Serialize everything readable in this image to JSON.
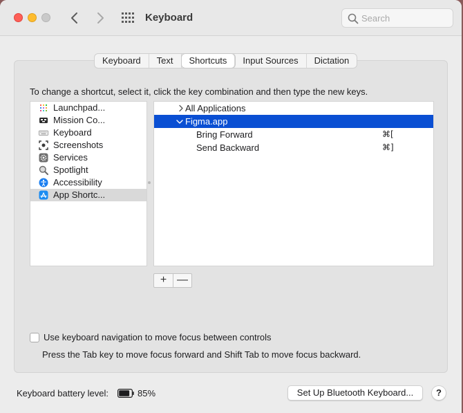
{
  "window": {
    "title": "Keyboard",
    "search_placeholder": "Search"
  },
  "tabs": [
    {
      "label": "Keyboard",
      "active": false
    },
    {
      "label": "Text",
      "active": false
    },
    {
      "label": "Shortcuts",
      "active": true
    },
    {
      "label": "Input Sources",
      "active": false
    },
    {
      "label": "Dictation",
      "active": false
    }
  ],
  "instruction": "To change a shortcut, select it, click the key combination and then type the new keys.",
  "categories": [
    {
      "label": "Launchpad...",
      "icon": "launchpad-icon"
    },
    {
      "label": "Mission Co...",
      "icon": "mission-control-icon"
    },
    {
      "label": "Keyboard",
      "icon": "keyboard-icon"
    },
    {
      "label": "Screenshots",
      "icon": "screenshots-icon"
    },
    {
      "label": "Services",
      "icon": "services-gear-icon"
    },
    {
      "label": "Spotlight",
      "icon": "spotlight-icon"
    },
    {
      "label": "Accessibility",
      "icon": "accessibility-icon"
    },
    {
      "label": "App Shortc...",
      "icon": "app-store-icon",
      "selected": true
    }
  ],
  "shortcuts": [
    {
      "label": "All Applications",
      "expanded": false
    },
    {
      "label": "Figma.app",
      "expanded": true,
      "selected": true
    },
    {
      "label": "Bring Forward",
      "key": "⌘["
    },
    {
      "label": "Send Backward",
      "key": "⌘]"
    }
  ],
  "buttons": {
    "add": "+",
    "remove": "—"
  },
  "keyboard_navigation": {
    "label": "Use keyboard navigation to move focus between controls",
    "checked": false,
    "help": "Press the Tab key to move focus forward and Shift Tab to move focus backward."
  },
  "footer": {
    "battery_label": "Keyboard battery level:",
    "battery_percent": "85%",
    "battery_level": 0.85,
    "bluetooth_button": "Set Up Bluetooth Keyboard...",
    "help_button": "?"
  },
  "colors": {
    "selection_blue": "#0a4fd3",
    "close": "#fe5f57",
    "minimize": "#febc2e",
    "zoom_disabled": "#c9c9c9"
  }
}
